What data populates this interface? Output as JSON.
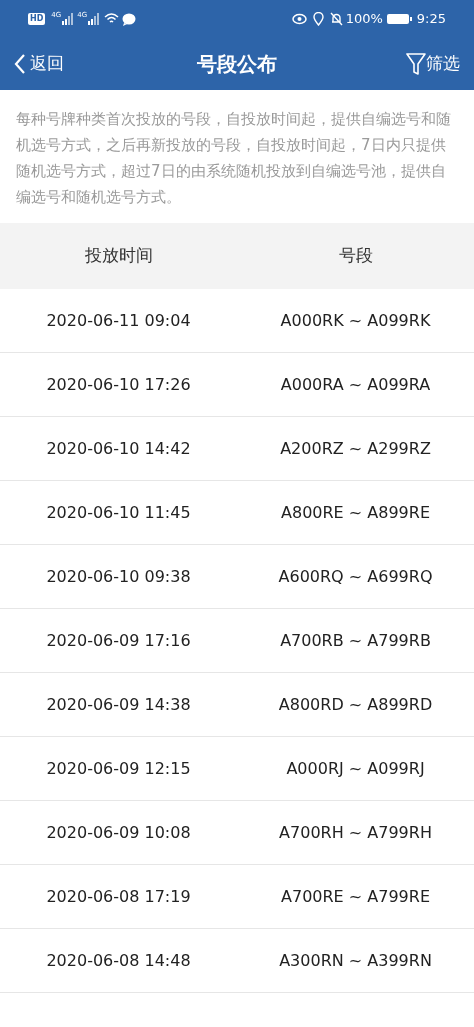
{
  "status_bar": {
    "hd": "HD",
    "network_1": "4G",
    "network_2": "4G",
    "battery": "100%",
    "time": "9:25"
  },
  "nav": {
    "back": "返回",
    "title": "号段公布",
    "filter": "筛选"
  },
  "notice": "每种号牌种类首次投放的号段，自投放时间起，提供自编选号和随机选号方式，之后再新投放的号段，自投放时间起，7日内只提供随机选号方式，超过7日的由系统随机投放到自编选号池，提供自编选号和随机选号方式。",
  "table": {
    "columns": [
      "投放时间",
      "号段"
    ],
    "rows": [
      [
        "2020-06-11 09:04",
        "A000RK ~ A099RK"
      ],
      [
        "2020-06-10 17:26",
        "A000RA ~ A099RA"
      ],
      [
        "2020-06-10 14:42",
        "A200RZ ~ A299RZ"
      ],
      [
        "2020-06-10 11:45",
        "A800RE ~ A899RE"
      ],
      [
        "2020-06-10 09:38",
        "A600RQ ~ A699RQ"
      ],
      [
        "2020-06-09 17:16",
        "A700RB ~ A799RB"
      ],
      [
        "2020-06-09 14:38",
        "A800RD ~ A899RD"
      ],
      [
        "2020-06-09 12:15",
        "A000RJ ~ A099RJ"
      ],
      [
        "2020-06-09 10:08",
        "A700RH ~ A799RH"
      ],
      [
        "2020-06-08 17:19",
        "A700RE ~ A799RE"
      ],
      [
        "2020-06-08 14:48",
        "A300RN ~ A399RN"
      ]
    ]
  }
}
